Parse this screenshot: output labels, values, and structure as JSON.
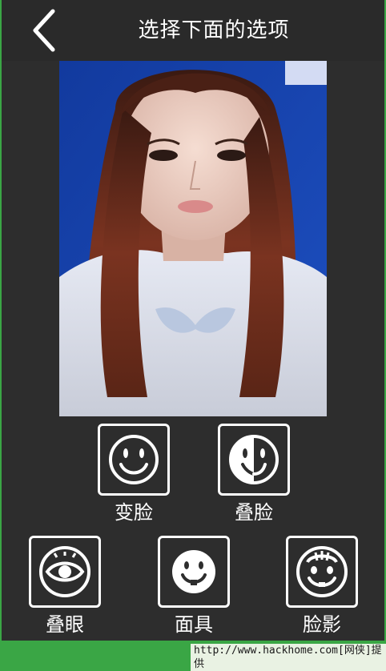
{
  "header": {
    "title": "选择下面的选项",
    "back_icon": "chevron-left-icon"
  },
  "photo": {
    "description_icon": "portrait-photo",
    "background_color": "#1b3da8"
  },
  "options": [
    {
      "label": "变脸",
      "icon": "smiley-face-icon"
    },
    {
      "label": "叠脸",
      "icon": "half-face-icon"
    },
    {
      "label": "叠眼",
      "icon": "eye-icon"
    },
    {
      "label": "面具",
      "icon": "mask-icon"
    },
    {
      "label": "脸影",
      "icon": "face-shadow-icon"
    }
  ],
  "footer": {
    "watermark": "http://www.hackhome.com[网侠]提供"
  },
  "colors": {
    "background": "#2d2d2d",
    "accent_green": "#3aa645",
    "text": "#ffffff"
  }
}
